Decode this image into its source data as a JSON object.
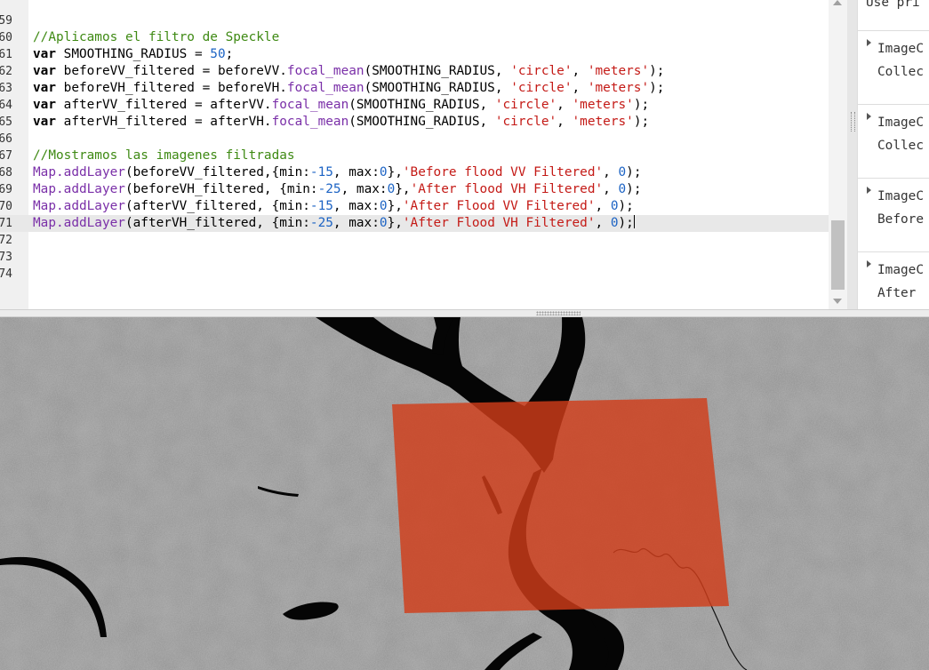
{
  "editor": {
    "lines": [
      {
        "num": "59",
        "tokens": []
      },
      {
        "num": "60",
        "tokens": [
          {
            "t": "//Aplicamos el filtro de Speckle",
            "c": "cm"
          }
        ]
      },
      {
        "num": "61",
        "tokens": [
          {
            "t": "var",
            "c": "kw"
          },
          {
            "t": " SMOOTHING_RADIUS = "
          },
          {
            "t": "50",
            "c": "num"
          },
          {
            "t": ";"
          }
        ]
      },
      {
        "num": "62",
        "tokens": [
          {
            "t": "var",
            "c": "kw"
          },
          {
            "t": " beforeVV_filtered = beforeVV."
          },
          {
            "t": "focal_mean",
            "c": "fn"
          },
          {
            "t": "(SMOOTHING_RADIUS, "
          },
          {
            "t": "'circle'",
            "c": "str"
          },
          {
            "t": ", "
          },
          {
            "t": "'meters'",
            "c": "str"
          },
          {
            "t": ");"
          }
        ]
      },
      {
        "num": "63",
        "tokens": [
          {
            "t": "var",
            "c": "kw"
          },
          {
            "t": " beforeVH_filtered = beforeVH."
          },
          {
            "t": "focal_mean",
            "c": "fn"
          },
          {
            "t": "(SMOOTHING_RADIUS, "
          },
          {
            "t": "'circle'",
            "c": "str"
          },
          {
            "t": ", "
          },
          {
            "t": "'meters'",
            "c": "str"
          },
          {
            "t": ");"
          }
        ]
      },
      {
        "num": "64",
        "tokens": [
          {
            "t": "var",
            "c": "kw"
          },
          {
            "t": " afterVV_filtered = afterVV."
          },
          {
            "t": "focal_mean",
            "c": "fn"
          },
          {
            "t": "(SMOOTHING_RADIUS, "
          },
          {
            "t": "'circle'",
            "c": "str"
          },
          {
            "t": ", "
          },
          {
            "t": "'meters'",
            "c": "str"
          },
          {
            "t": ");"
          }
        ]
      },
      {
        "num": "65",
        "tokens": [
          {
            "t": "var",
            "c": "kw"
          },
          {
            "t": " afterVH_filtered = afterVH."
          },
          {
            "t": "focal_mean",
            "c": "fn"
          },
          {
            "t": "(SMOOTHING_RADIUS, "
          },
          {
            "t": "'circle'",
            "c": "str"
          },
          {
            "t": ", "
          },
          {
            "t": "'meters'",
            "c": "str"
          },
          {
            "t": ");"
          }
        ]
      },
      {
        "num": "66",
        "tokens": []
      },
      {
        "num": "67",
        "tokens": [
          {
            "t": "//Mostramos las imagenes filtradas",
            "c": "cm"
          }
        ]
      },
      {
        "num": "68",
        "tokens": [
          {
            "t": "Map.addLayer",
            "c": "fn"
          },
          {
            "t": "(beforeVV_filtered,{min:"
          },
          {
            "t": "-15",
            "c": "num"
          },
          {
            "t": ", max:"
          },
          {
            "t": "0",
            "c": "num"
          },
          {
            "t": "},"
          },
          {
            "t": "'Before flood VV Filtered'",
            "c": "str"
          },
          {
            "t": ", "
          },
          {
            "t": "0",
            "c": "num"
          },
          {
            "t": ");"
          }
        ]
      },
      {
        "num": "69",
        "tokens": [
          {
            "t": "Map.addLayer",
            "c": "fn"
          },
          {
            "t": "(beforeVH_filtered, {min:"
          },
          {
            "t": "-25",
            "c": "num"
          },
          {
            "t": ", max:"
          },
          {
            "t": "0",
            "c": "num"
          },
          {
            "t": "},"
          },
          {
            "t": "'After flood VH Filtered'",
            "c": "str"
          },
          {
            "t": ", "
          },
          {
            "t": "0",
            "c": "num"
          },
          {
            "t": ");"
          }
        ]
      },
      {
        "num": "70",
        "tokens": [
          {
            "t": "Map.addLayer",
            "c": "fn"
          },
          {
            "t": "(afterVV_filtered, {min:"
          },
          {
            "t": "-15",
            "c": "num"
          },
          {
            "t": ", max:"
          },
          {
            "t": "0",
            "c": "num"
          },
          {
            "t": "},"
          },
          {
            "t": "'After Flood VV Filtered'",
            "c": "str"
          },
          {
            "t": ", "
          },
          {
            "t": "0",
            "c": "num"
          },
          {
            "t": ");"
          }
        ]
      },
      {
        "num": "71",
        "active": true,
        "tokens": [
          {
            "t": "Map.addLayer",
            "c": "fn"
          },
          {
            "t": "(afterVH_filtered, {min:"
          },
          {
            "t": "-25",
            "c": "num"
          },
          {
            "t": ", max:"
          },
          {
            "t": "0",
            "c": "num"
          },
          {
            "t": "},"
          },
          {
            "t": "'After Flood VH Filtered'",
            "c": "str"
          },
          {
            "t": ", "
          },
          {
            "t": "0",
            "c": "num"
          },
          {
            "t": ");"
          }
        ]
      },
      {
        "num": "72",
        "tokens": []
      },
      {
        "num": "73",
        "tokens": []
      },
      {
        "num": "74",
        "tokens": []
      }
    ]
  },
  "side_panel": {
    "top_text": "Use pri",
    "items": [
      {
        "line1": "ImageC",
        "line2": "Collec"
      },
      {
        "line1": "ImageC",
        "line2": "Collec"
      },
      {
        "line1": "ImageC",
        "line2": "Before"
      },
      {
        "line1": "ImageC",
        "line2": "After "
      }
    ]
  },
  "map": {
    "overlay_color": "#d13d1a",
    "water_color": "#000000",
    "land_color": "#8f8f8f"
  }
}
